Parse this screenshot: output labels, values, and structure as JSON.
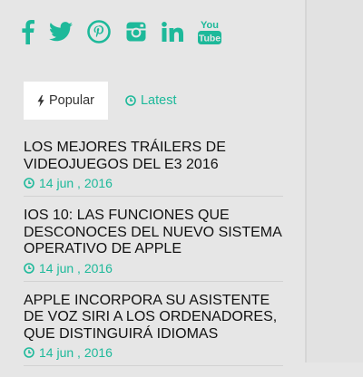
{
  "colors": {
    "accent": "#1db99a",
    "background": "#e6e6e6",
    "title_text": "#111111"
  },
  "social": [
    {
      "name": "facebook",
      "icon": "facebook-icon"
    },
    {
      "name": "twitter",
      "icon": "twitter-icon"
    },
    {
      "name": "pinterest",
      "icon": "pinterest-icon"
    },
    {
      "name": "instagram",
      "icon": "instagram-icon"
    },
    {
      "name": "linkedin",
      "icon": "linkedin-icon"
    },
    {
      "name": "youtube",
      "icon": "youtube-icon",
      "line1": "You",
      "line2": "Tube"
    }
  ],
  "tabs": [
    {
      "label": "Popular",
      "icon": "bolt-icon",
      "active": true
    },
    {
      "label": "Latest",
      "icon": "clock-icon",
      "active": false
    }
  ],
  "posts": [
    {
      "title": "LOS MEJORES TRÁILERS DE VIDEOJUEGOS DEL E3 2016",
      "date": "14 jun , 2016"
    },
    {
      "title": "IOS 10: LAS FUNCIONES QUE DESCONOCES DEL NUEVO SISTEMA OPERATIVO DE APPLE",
      "date": "14 jun , 2016"
    },
    {
      "title": "APPLE INCORPORA SU ASISTENTE DE VOZ SIRI A LOS ORDENADORES, QUE DISTINGUIRÁ IDIOMAS",
      "date": "14 jun , 2016"
    }
  ]
}
